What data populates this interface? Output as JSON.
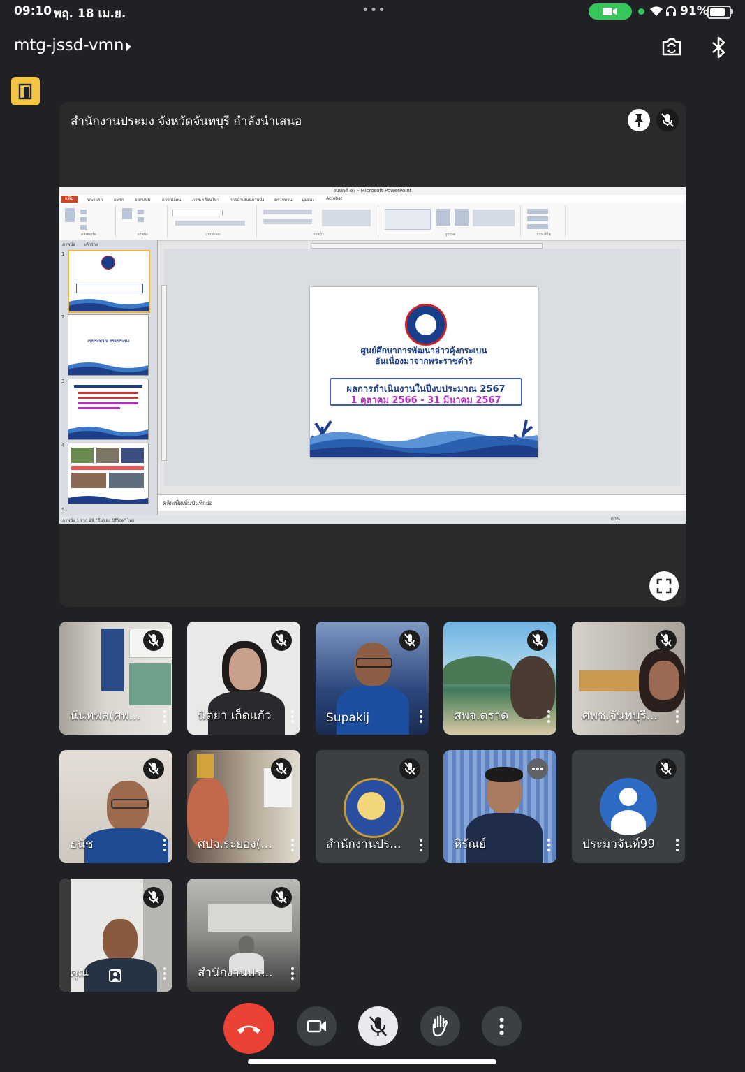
{
  "status_bar": {
    "time": "09:10",
    "date": "พฤ. 18 เม.ย.",
    "battery": "91%"
  },
  "meeting": {
    "code": "mtg-jssd-vmn"
  },
  "presentation": {
    "label": "สำนักงานประมง จังหวัดจันทบุรี กำลังนำเสนอ",
    "window_title": "งบปกติ 67 - Microsoft PowerPoint",
    "file_tab": "แฟ้ม",
    "ribbon_tabs": [
      "หน้าแรก",
      "แทรก",
      "ออกแบบ",
      "การเปลี่ยน",
      "ภาพเคลื่อนไหว",
      "การนำเสนอภาพนิ่ง",
      "ตรวจทาน",
      "มุมมอง",
      "Acrobat"
    ],
    "ribbon_groups": [
      "คลิปบอร์ด",
      "ภาพนิ่ง",
      "แบบอักษร",
      "ย่อหน้า",
      "รูปวาด",
      "การแก้ไข"
    ],
    "pane_tabs": [
      "ภาพนิ่ง",
      "เค้าร่าง"
    ],
    "slide": {
      "heading_1": "ศูนย์ศึกษาการพัฒนาอ่าวคุ้งกระเบน",
      "heading_2": "อันเนื่องมาจากพระราชดำริ",
      "box_line_1": "ผลการดำเนินงานในปีงบประมาณ 2567",
      "box_line_2": "1 ตุลาคม 2566 - 31 มีนาคม 2567"
    },
    "thumb_2_text": "งบประมาณ กรมประมง",
    "notes_placeholder": "คลิกเพื่อเพิ่มบันทึกย่อ",
    "status_text": "ภาพนิ่ง 1 จาก 28   \"ธีมของ Office\"   ไทย",
    "zoom": "60%"
  },
  "participants": [
    {
      "name": "นันทพล(ศพ...",
      "muted": true
    },
    {
      "name": "นิตยา เก็ดแก้ว",
      "muted": true
    },
    {
      "name": "Supakij",
      "muted": true
    },
    {
      "name": "ศพจ.ตราด",
      "muted": true
    },
    {
      "name": "ศพช.จันทบุรี...",
      "muted": true
    },
    {
      "name": "ธนัช",
      "muted": true
    },
    {
      "name": "ศปจ.ระยอง(...",
      "muted": true
    },
    {
      "name": "สำนักงานปร...",
      "muted": true
    },
    {
      "name": "หิรัณย์",
      "muted": false
    },
    {
      "name": "ประมวจันท์99",
      "muted": true
    },
    {
      "name": "คุณ",
      "muted": true
    },
    {
      "name": "สำนักงานปร...",
      "muted": true
    }
  ],
  "icons": [
    "camera-flip-icon",
    "bluetooth-icon",
    "pin-icon",
    "mic-off-icon",
    "fullscreen-icon",
    "end-call-icon",
    "camera-icon",
    "hand-raise-icon",
    "more-icon",
    "add-person-icon"
  ],
  "colors": {
    "end_call": "#ea4335",
    "accent_yellow": "#f4c542",
    "camera_pill": "#35c759"
  }
}
